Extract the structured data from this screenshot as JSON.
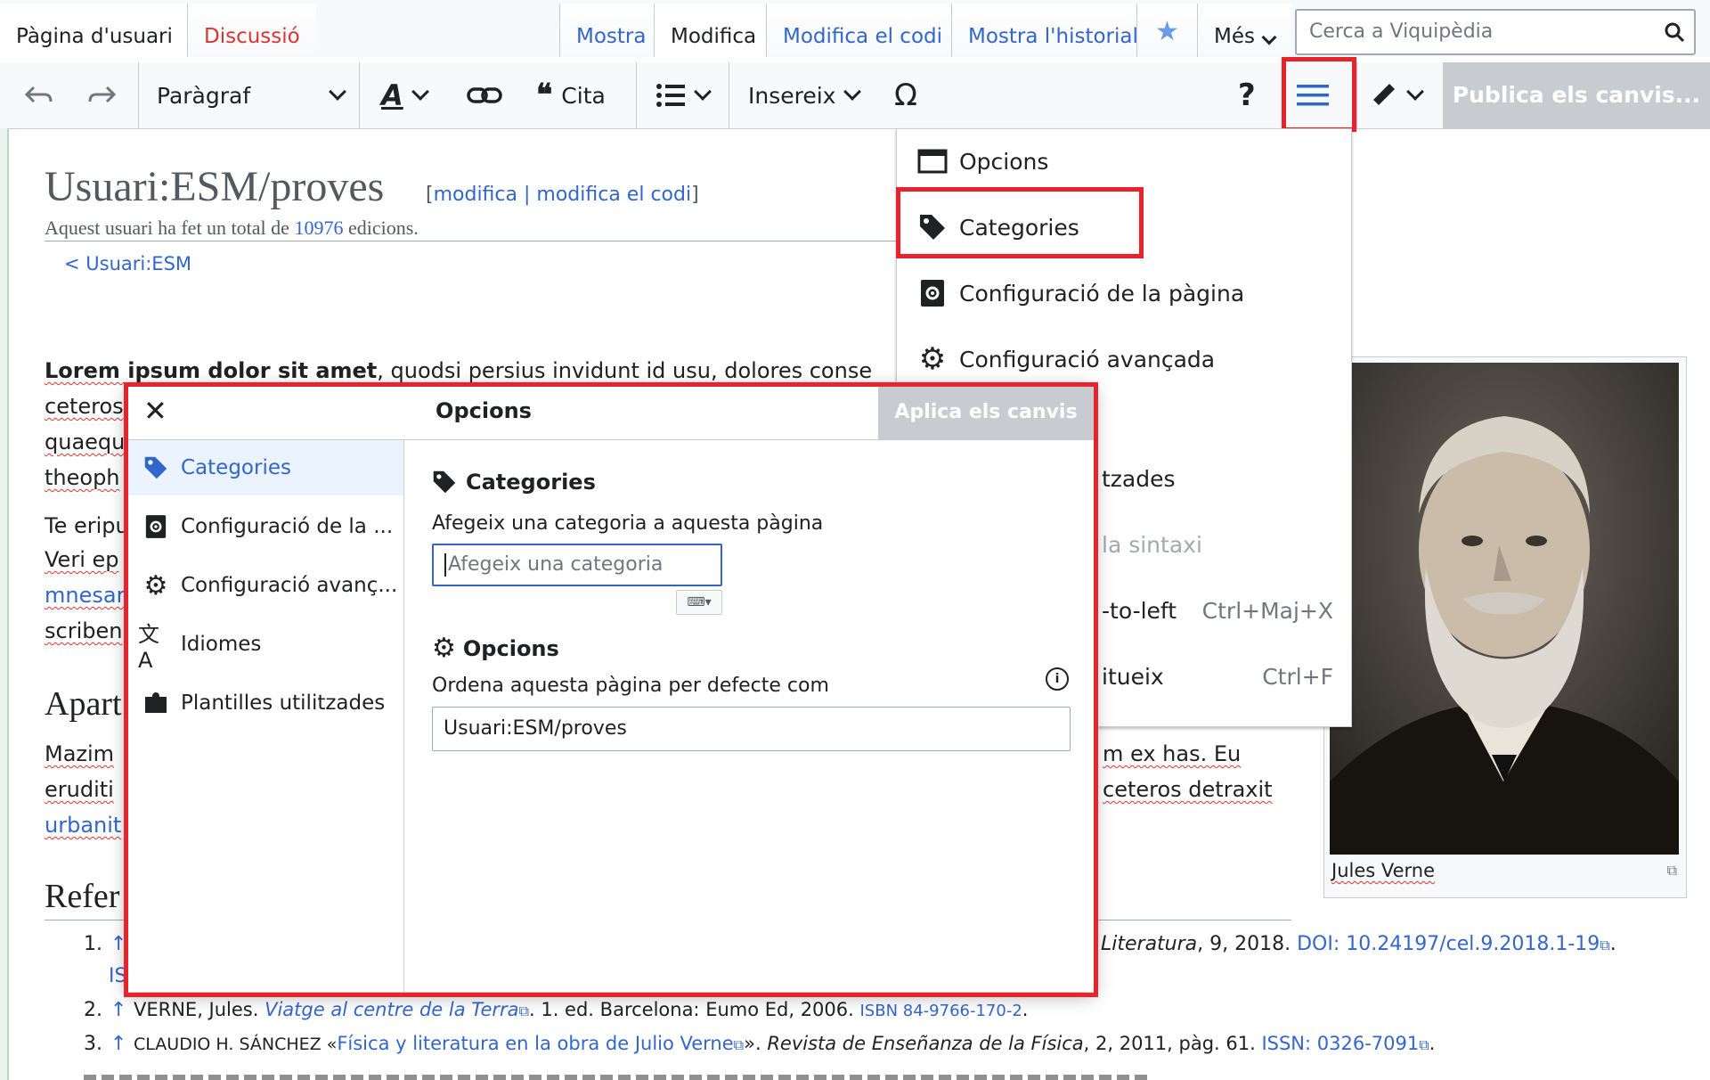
{
  "top_tabs": {
    "user_page": "Pàgina d'usuari",
    "discussion": "Discussió",
    "show": "Mostra",
    "edit": "Modifica",
    "edit_source": "Modifica el codi",
    "history": "Mostra l'historial",
    "more": "Més"
  },
  "search": {
    "placeholder": "Cerca a Viquipèdia"
  },
  "toolbar": {
    "paragraph": "Paràgraf",
    "cite": "Cita",
    "insert": "Insereix",
    "help": "?",
    "publish": "Publica els canvis..."
  },
  "page": {
    "title": "Usuari:ESM/proves",
    "edit_links_open": "[",
    "edit_link": "modifica",
    "edit_links_sep": " | ",
    "edit_source_link": "modifica el codi",
    "edit_links_close": "]",
    "subtitle_pre": "Aquest usuari ha fet un total de ",
    "subtitle_count": "10976",
    "subtitle_post": " edicions.",
    "breadcrumb": "< Usuari:ESM",
    "p1_bold": "Lorem ipsum dolor sit amet",
    "p1_rest": ", quodsi persius invidunt id usu, dolores conse",
    "p1_l2": "ceteros",
    "p1_l3": "quaequ",
    "p1_l4": "theoph",
    "p2_l1": "Te eripu",
    "p2_l2": "Veri ep",
    "p2_l3": "mnesar",
    "p2_l4": "scriben",
    "heading_apart": "Apart",
    "p3_l1": "Mazim",
    "p3_l2": "eruditi",
    "p3_l3": "urbanit",
    "p3_r1": "m ex has. Eu",
    "p3_r2": "ceteros detraxit",
    "heading_refs": "Refer",
    "ref1_num": "1.",
    "ref1_arrow": "↑",
    "ref1_text": "Literatura",
    "ref1_mid": ", 9, 2018. ",
    "ref1_doi_label": "DOI",
    "ref1_doi": ": 10.24197/cel.9.2018.1-19",
    "ref1_end": ".",
    "ref1_l2": "IS",
    "ref2_num": "2.",
    "ref2_arrow": "↑",
    "ref2_author": "VERNE, Jules. ",
    "ref2_title": "Viatge al centre de la Terra",
    "ref2_mid": ". 1. ed. Barcelona: Eumo Ed, 2006. ",
    "ref2_isbn": "ISBN 84-9766-170-2",
    "ref2_end": ".",
    "ref3_num": "3.",
    "ref3_arrow": "↑",
    "ref3_author": "CLAUDIO H. SÁNCHEZ «",
    "ref3_title": "Física y literatura en la obra de Julio Verne",
    "ref3_mid": "». ",
    "ref3_journal": "Revista de Enseñanza de la Física",
    "ref3_rest": ", 2, 2011, pàg. 61. ",
    "ref3_issn_label": "ISSN",
    "ref3_issn": ": 0326-7091",
    "ref3_end": ".",
    "image_caption": "Jules Verne"
  },
  "menu": {
    "items": [
      {
        "label": "Opcions"
      },
      {
        "label": "Categories"
      },
      {
        "label": "Configuració de la pàgina"
      },
      {
        "label": "Configuració avançada"
      }
    ],
    "partial": [
      {
        "label": "tzades",
        "shortcut": ""
      },
      {
        "label": "la sintaxi",
        "shortcut": ""
      },
      {
        "label": "-to-left",
        "shortcut": "Ctrl+Maj+X"
      },
      {
        "label": "itueix",
        "shortcut": "Ctrl+F"
      }
    ]
  },
  "dialog": {
    "title": "Opcions",
    "apply": "Aplica els canvis",
    "sidebar": [
      {
        "label": "Categories"
      },
      {
        "label": "Configuració de la ..."
      },
      {
        "label": "Configuració avanç..."
      },
      {
        "label": "Idiomes"
      },
      {
        "label": "Plantilles utilitzades"
      }
    ],
    "categories_heading": "Categories",
    "categories_label": "Afegeix una categoria a aquesta pàgina",
    "categories_placeholder": "Afegeix una categoria",
    "options_heading": "Opcions",
    "sort_label": "Ordena aquesta pàgina per defecte com",
    "sort_value": "Usuari:ESM/proves"
  },
  "colors": {
    "highlight": "#e8232b",
    "link": "#3366cc",
    "redlink": "#d33"
  }
}
